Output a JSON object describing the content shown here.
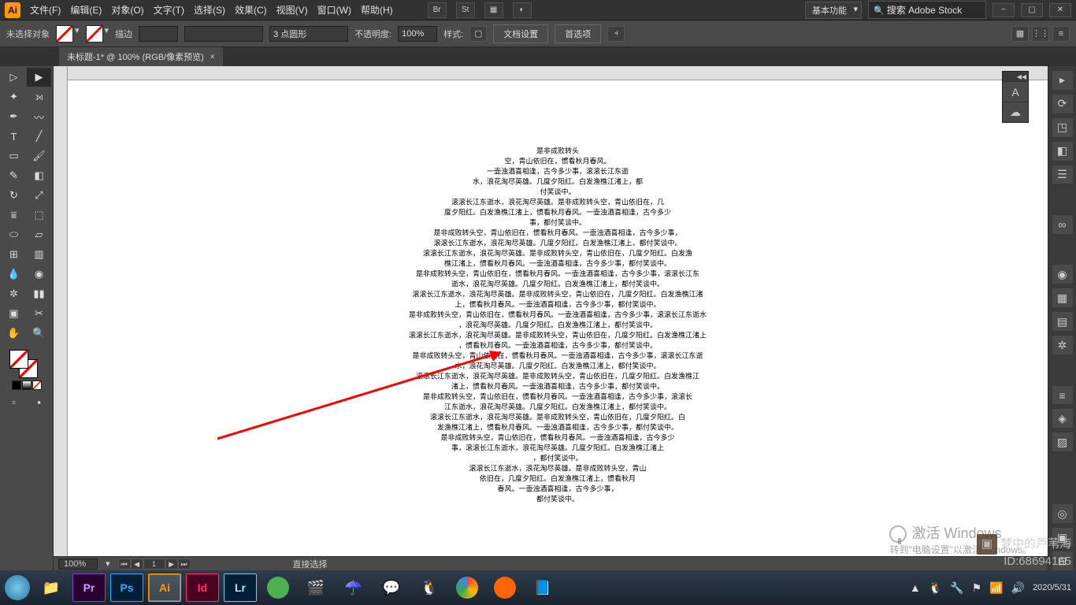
{
  "menu": {
    "file": "文件(F)",
    "edit": "编辑(E)",
    "object": "对象(O)",
    "type": "文字(T)",
    "select": "选择(S)",
    "effect": "效果(C)",
    "view": "视图(V)",
    "window": "窗口(W)",
    "help": "帮助(H)"
  },
  "menubar_icons": {
    "br": "Br",
    "st": "St"
  },
  "workspace": "基本功能",
  "search_ph": "搜索 Adobe Stock",
  "ctrl": {
    "noobj": "未选择对象",
    "stroke": "描边",
    "dash_val": "3 点圆形",
    "opacity": "不透明度:",
    "opacity_val": "100%",
    "style": "样式:",
    "docset": "文档设置",
    "prefs": "首选项"
  },
  "doc": {
    "title": "未标题-1* @ 100% (RGB/像素预览)",
    "close": "×"
  },
  "statusbar": {
    "zoom": "100%",
    "pageno": "1",
    "tool": "直接选择"
  },
  "wm": {
    "l1": "激活 Windows",
    "l2": "转到\"电脑设置\"以激活 Windows。"
  },
  "attrib": {
    "l1": "梦中的芦苇海",
    "l2": "ID:68694165"
  },
  "tray": {
    "date": "2020/5/31"
  },
  "apps": {
    "pr": "Pr",
    "ps": "Ps",
    "ai": "Ai",
    "id": "Id",
    "lr": "Lr"
  },
  "text_lines": [
    "是非成败转头",
    "空，青山依旧在，惯看秋月春风。",
    "一壶浊酒喜相逢，古今多少事，滚滚长江东逝",
    "水，浪花淘尽英雄。几度夕阳红。白发渔樵江渚上，都",
    "付笑谈中。",
    "滚滚长江东逝水，浪花淘尽英雄。是非成败转头空，青山依旧在，几",
    "度夕阳红。白发渔樵江渚上，惯看秋月春风。一壶浊酒喜相逢，古今多少",
    "事，都付笑谈中。",
    "是非成败转头空，青山依旧在，惯看秋月春风。一壶浊酒喜相逢，古今多少事，",
    "滚滚长江东逝水，浪花淘尽英雄。几度夕阳红。白发渔樵江渚上，都付笑谈中。",
    "滚滚长江东逝水，浪花淘尽英雄。是非成败转头空，青山依旧在，几度夕阳红。白发渔",
    "樵江渚上，惯看秋月春风。一壶浊酒喜相逢，古今多少事，都付笑谈中。",
    "是非成败转头空，青山依旧在，惯看秋月春风。一壶浊酒喜相逢，古今多少事，滚滚长江东",
    "逝水，浪花淘尽英雄。几度夕阳红。白发渔樵江渚上，都付笑谈中。",
    "滚滚长江东逝水，浪花淘尽英雄。是非成败转头空，青山依旧在，几度夕阳红。白发渔樵江渚",
    "上，惯看秋月春风。一壶浊酒喜相逢，古今多少事，都付笑谈中。",
    "是非成败转头空，青山依旧在，惯看秋月春风。一壶浊酒喜相逢，古今多少事，滚滚长江东逝水",
    "，浪花淘尽英雄。几度夕阳红。白发渔樵江渚上，都付笑谈中。",
    "滚滚长江东逝水，浪花淘尽英雄。是非成败转头空，青山依旧在，几度夕阳红。白发渔樵江渚上",
    "，惯看秋月春风。一壶浊酒喜相逢，古今多少事，都付笑谈中。",
    "是非成败转头空，青山依旧在，惯看秋月春风。一壶浊酒喜相逢，古今多少事，滚滚长江东逝",
    "水，浪花淘尽英雄。几度夕阳红。白发渔樵江渚上，都付笑谈中。",
    "滚滚长江东逝水，浪花淘尽英雄。是非成败转头空，青山依旧在，几度夕阳红。白发渔樵江",
    "渚上，惯看秋月春风。一壶浊酒喜相逢，古今多少事，都付笑谈中。",
    "是非成败转头空，青山依旧在，惯看秋月春风。一壶浊酒喜相逢，古今多少事，滚滚长",
    "江东逝水，浪花淘尽英雄。几度夕阳红。白发渔樵江渚上，都付笑谈中。",
    "滚滚长江东逝水，浪花淘尽英雄。是非成败转头空，青山依旧在，几度夕阳红。白",
    "发渔樵江渚上，惯看秋月春风。一壶浊酒喜相逢，古今多少事，都付笑谈中。",
    "是非成败转头空，青山依旧在，惯看秋月春风。一壶浊酒喜相逢，古今多少",
    "事，滚滚长江东逝水，浪花淘尽英雄。几度夕阳红。白发渔樵江渚上",
    "，都付笑谈中。",
    "滚滚长江东逝水，浪花淘尽英雄。是非成败转头空，青山",
    "依旧在，几度夕阳红。白发渔樵江渚上，惯看秋月",
    "春风。一壶浊酒喜相逢，古今多少事，",
    "都付笑谈中。"
  ]
}
